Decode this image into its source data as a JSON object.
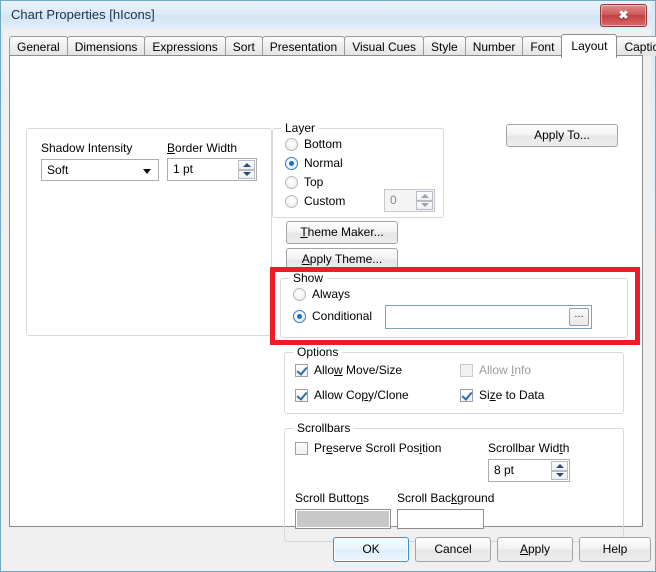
{
  "window": {
    "title": "Chart Properties [hIcons]",
    "close_label": "✖",
    "accent_border": "#6fa8c4",
    "highlight_color": "#ee1c25"
  },
  "tabs": [
    {
      "label": "General",
      "active": false
    },
    {
      "label": "Dimensions",
      "active": false
    },
    {
      "label": "Expressions",
      "active": false
    },
    {
      "label": "Sort",
      "active": false
    },
    {
      "label": "Presentation",
      "active": false
    },
    {
      "label": "Visual Cues",
      "active": false
    },
    {
      "label": "Style",
      "active": false
    },
    {
      "label": "Number",
      "active": false
    },
    {
      "label": "Font",
      "active": false
    },
    {
      "label": "Layout",
      "active": true
    },
    {
      "label": "Caption",
      "active": false
    }
  ],
  "left_panel": {
    "shadow_intensity": {
      "label": "Shadow Intensity",
      "value": "Soft"
    },
    "border_width": {
      "label": "Border Width",
      "label_accel": "B",
      "value": "1 pt"
    }
  },
  "layer": {
    "legend": "Layer",
    "options": [
      {
        "label": "Bottom",
        "selected": false
      },
      {
        "label": "Normal",
        "selected": true
      },
      {
        "label": "Top",
        "selected": false
      },
      {
        "label": "Custom",
        "selected": false
      }
    ],
    "custom_value": "0",
    "custom_enabled": false
  },
  "theme_buttons": {
    "theme_maker": "Theme Maker...",
    "apply_theme": "Apply Theme..."
  },
  "apply_to": {
    "label": "Apply To..."
  },
  "show": {
    "legend": "Show",
    "options": [
      {
        "label": "Always",
        "selected": false
      },
      {
        "label": "Conditional",
        "selected": true
      }
    ],
    "conditional_value": "",
    "browse_label": "..."
  },
  "options": {
    "legend": "Options",
    "items": [
      {
        "label": "Allow Move/Size",
        "checked": true,
        "disabled": false
      },
      {
        "label": "Allow Info",
        "checked": false,
        "disabled": true
      },
      {
        "label": "Allow Copy/Clone",
        "checked": true,
        "disabled": false
      },
      {
        "label": "Size to Data",
        "checked": true,
        "disabled": false
      }
    ]
  },
  "scrollbars": {
    "legend": "Scrollbars",
    "preserve_scroll_position": {
      "label": "Preserve Scroll Position",
      "checked": false
    },
    "scrollbar_width": {
      "label": "Scrollbar Width",
      "value": "8 pt"
    },
    "scroll_buttons": {
      "label": "Scroll Buttons",
      "color": "#c8c8c8"
    },
    "scroll_background": {
      "label": "Scroll Background",
      "color": "#ffffff"
    }
  },
  "footer": {
    "ok": "OK",
    "cancel": "Cancel",
    "apply": "Apply",
    "help": "Help"
  }
}
